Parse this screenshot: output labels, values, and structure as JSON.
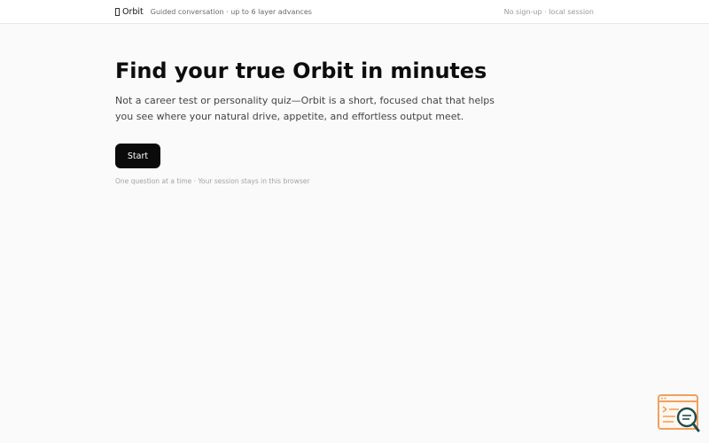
{
  "header": {
    "brand_name": "Orbit",
    "brand_icon": "glyph-box-icon",
    "tagline": "Guided conversation · up to 6 layer advances",
    "status": "No sign-up · local session"
  },
  "hero": {
    "title": "Find your true Orbit in minutes",
    "description": "Not a career test or personality quiz—Orbit is a short, focused chat that helps you see where your natural drive, appetite, and effortless output meet.",
    "start_label": "Start",
    "footnote": "One question at a time · Your session stays in this browser"
  },
  "widget": {
    "icon": "search-window-icon",
    "accent": "#f0a060",
    "lens_color": "#1f4d4d"
  },
  "colors": {
    "background": "#fafafa",
    "button": "#0b0b0b"
  }
}
